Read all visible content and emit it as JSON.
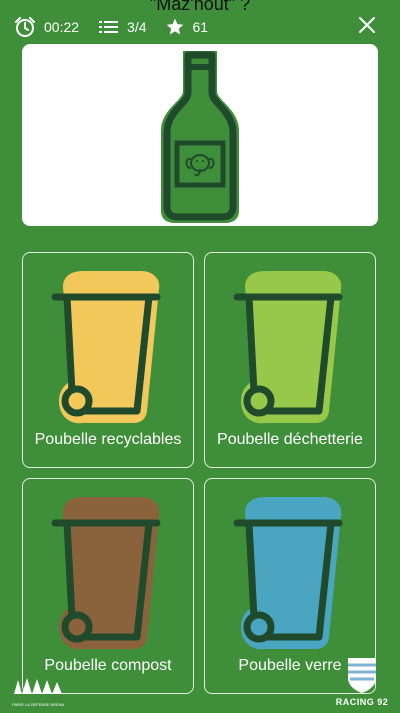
{
  "question": {
    "title": "\"Maz'hout\" ?"
  },
  "status": {
    "timer": "00:22",
    "progress": "3/4",
    "score": "61"
  },
  "icons": {
    "timer": "alarm-clock-icon",
    "progress": "list-icon",
    "score": "star-icon",
    "close": "close-icon",
    "item": "bottle-icon"
  },
  "bins": [
    {
      "label": "Poubelle recyclables",
      "color": "#f2c85b",
      "icon": "trash-bin-icon"
    },
    {
      "label": "Poubelle déchetterie",
      "color": "#98c84a",
      "icon": "trash-bin-icon"
    },
    {
      "label": "Poubelle compost",
      "color": "#8a623c",
      "icon": "trash-bin-icon"
    },
    {
      "label": "Poubelle verre",
      "color": "#4aa6c0",
      "icon": "trash-bin-icon"
    }
  ],
  "footer": {
    "left_logo": "PARIS LA DEFENSE ARENA",
    "right_logo": "RACING 92"
  },
  "colors": {
    "background": "#3f8f3a",
    "outline": "#1f4a2c",
    "bottle": "#3f8f3a"
  }
}
